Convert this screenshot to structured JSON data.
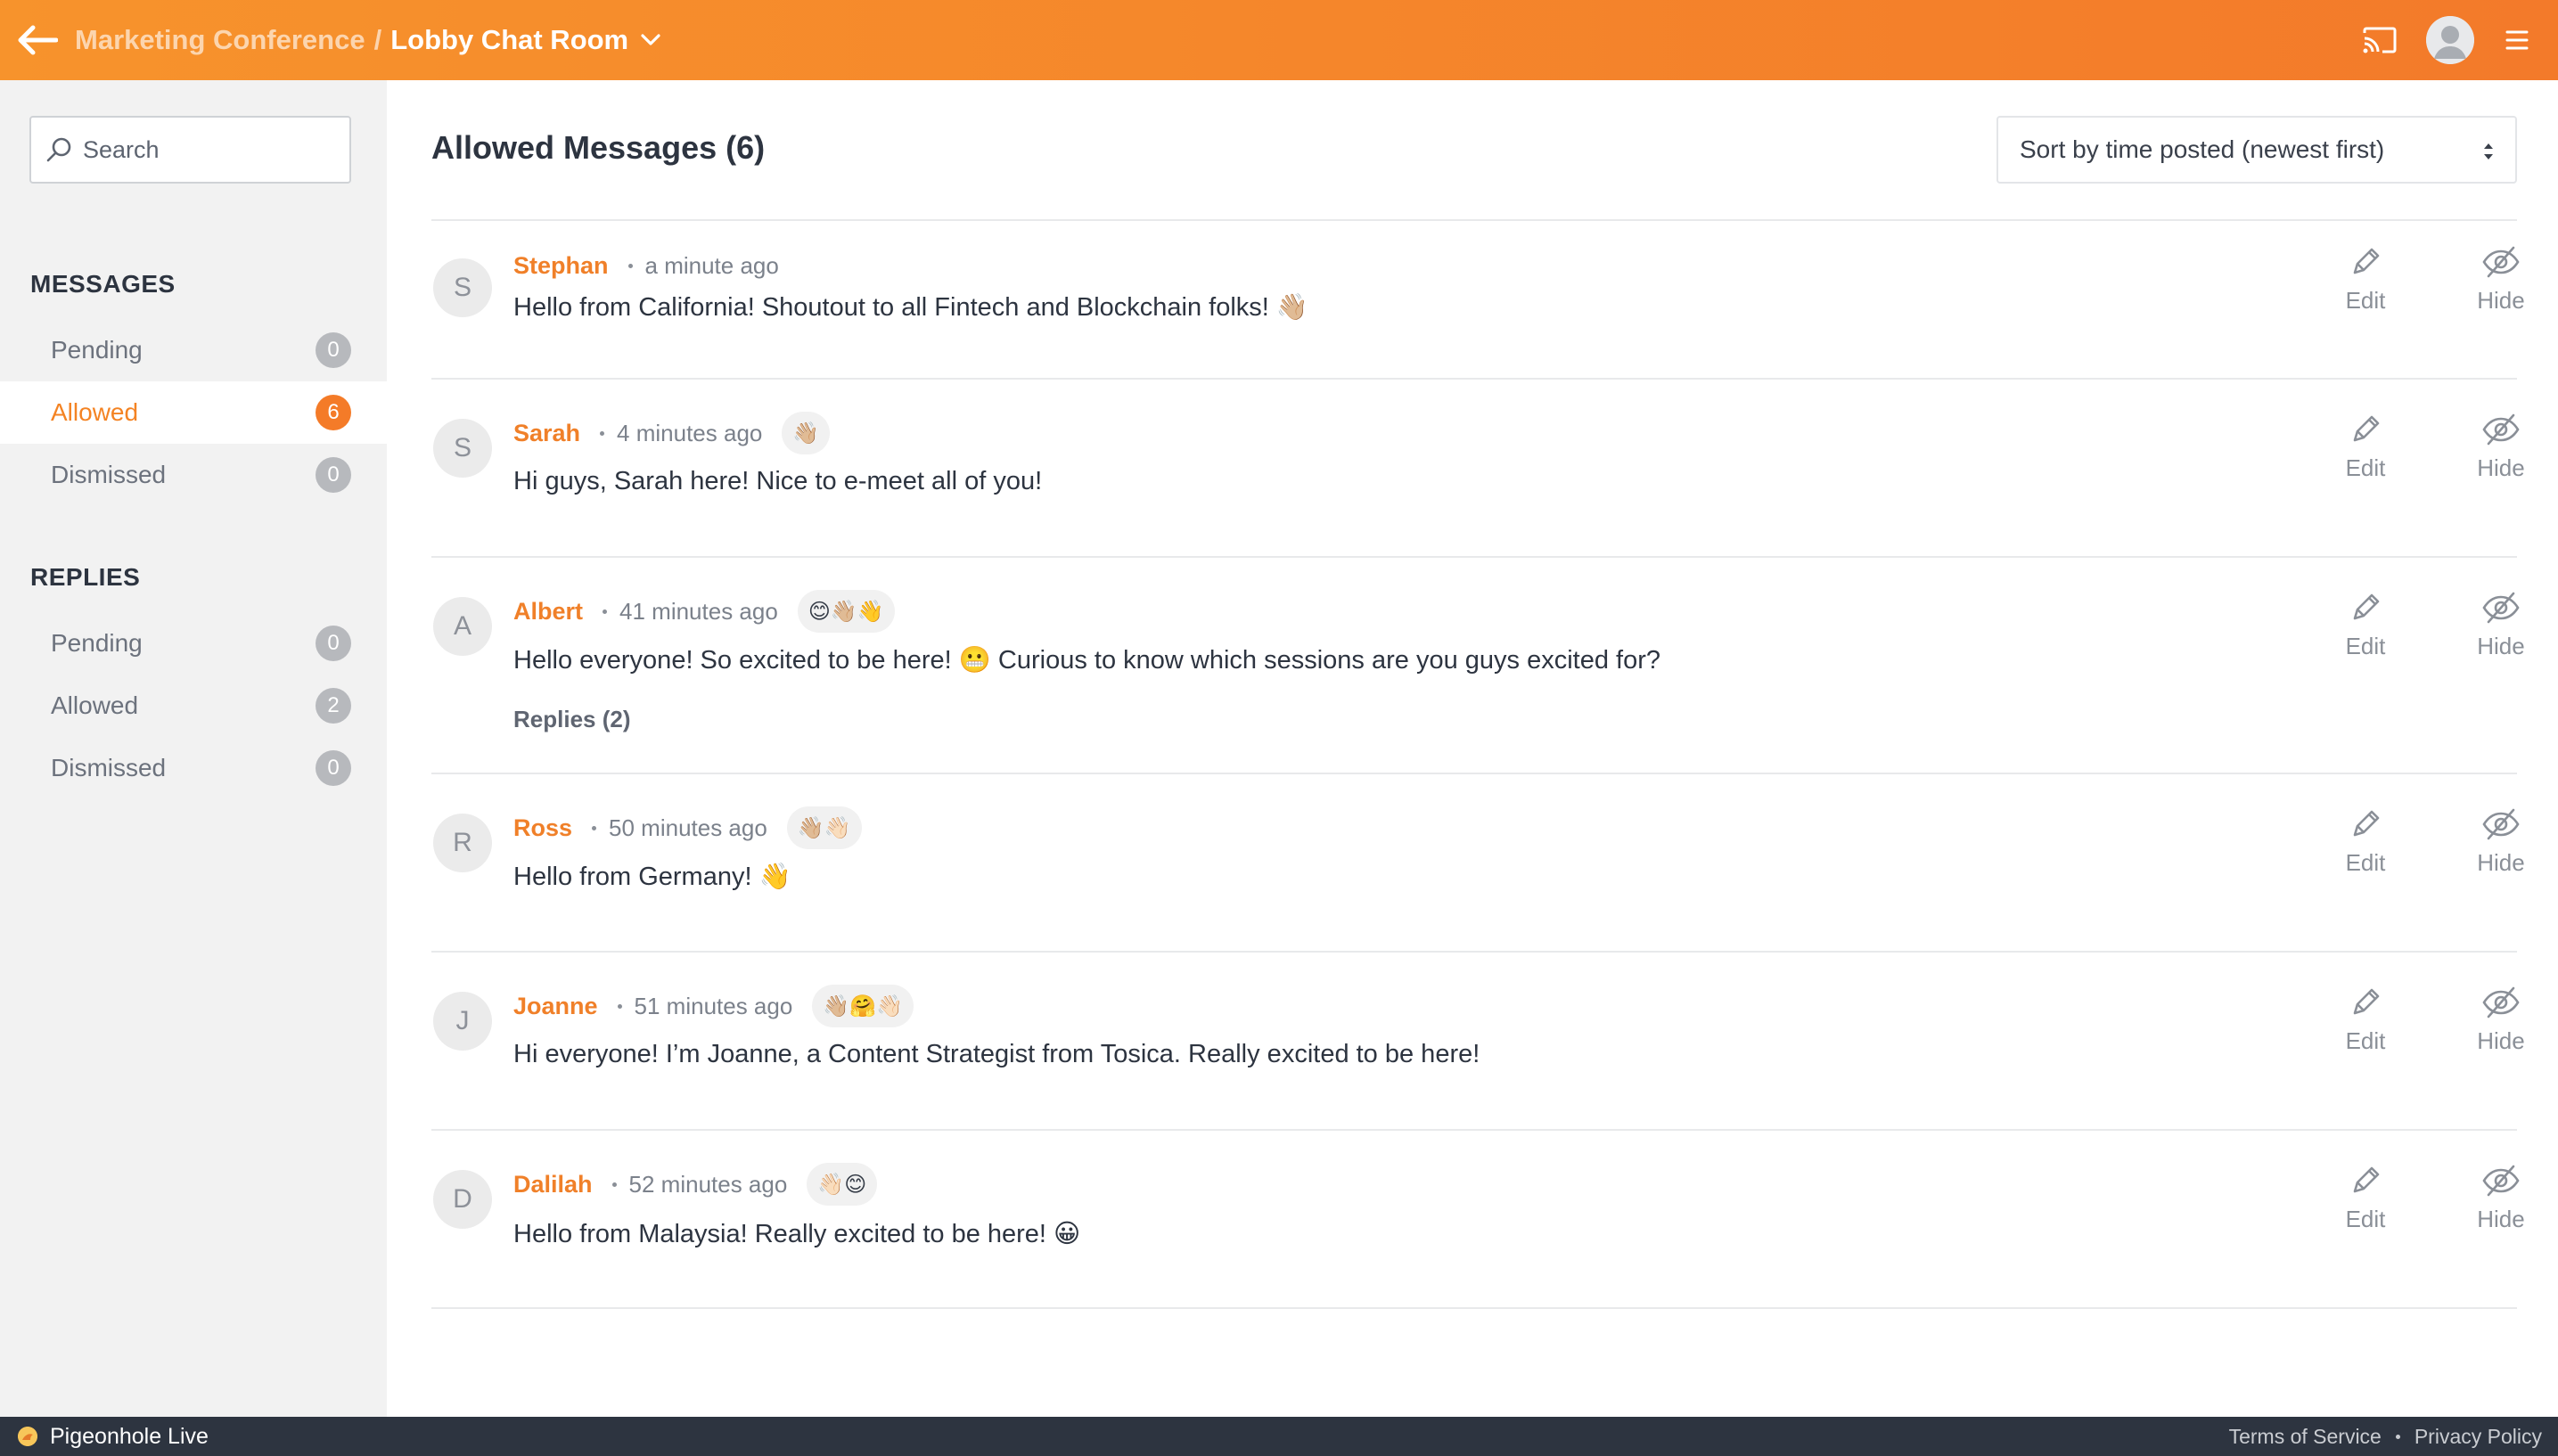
{
  "header": {
    "back_icon": "arrow-left-icon",
    "event_name": "Marketing Conference",
    "separator": "/",
    "room_name": "Lobby Chat Room",
    "accent": "#f58a2b"
  },
  "sidebar": {
    "search": {
      "placeholder": "Search",
      "value": ""
    },
    "messages": {
      "title": "MESSAGES",
      "items": [
        {
          "label": "Pending",
          "count": "0"
        },
        {
          "label": "Allowed",
          "count": "6"
        },
        {
          "label": "Dismissed",
          "count": "0"
        }
      ]
    },
    "replies": {
      "title": "REPLIES",
      "items": [
        {
          "label": "Pending",
          "count": "0"
        },
        {
          "label": "Allowed",
          "count": "2"
        },
        {
          "label": "Dismissed",
          "count": "0"
        }
      ]
    }
  },
  "main": {
    "title": "Allowed Messages (6)",
    "sort_value": "Sort by time posted (newest first)",
    "edit_label": "Edit",
    "hide_label": "Hide",
    "messages": [
      {
        "initial": "S",
        "author": "Stephan",
        "time": "a minute ago",
        "reactions": "",
        "text": "Hello from California! Shoutout to all Fintech and Blockchain folks! 👋🏼",
        "replies": ""
      },
      {
        "initial": "S",
        "author": "Sarah",
        "time": "4 minutes ago",
        "reactions": "👋🏼",
        "text": "Hi guys, Sarah here! Nice to e-meet all of you!",
        "replies": ""
      },
      {
        "initial": "A",
        "author": "Albert",
        "time": "41 minutes ago",
        "reactions": "😊👋🏼👋",
        "text": "Hello everyone! So excited to be here! 😬 Curious to know which sessions are you guys excited for?",
        "replies": "Replies (2)"
      },
      {
        "initial": "R",
        "author": "Ross",
        "time": "50 minutes ago",
        "reactions": "👋🏼👋🏻",
        "text": "Hello from Germany! 👋",
        "replies": ""
      },
      {
        "initial": "J",
        "author": "Joanne",
        "time": "51 minutes ago",
        "reactions": "👋🏼🤗👋🏻",
        "text": "Hi everyone! I’m Joanne, a Content Strategist from Tosica. Really excited to be here!",
        "replies": ""
      },
      {
        "initial": "D",
        "author": "Dalilah",
        "time": "52 minutes ago",
        "reactions": "👋🏻😊",
        "text": "Hello from Malaysia! Really excited to be here! 😀",
        "replies": ""
      }
    ]
  },
  "footer": {
    "brand": "Pigeonhole Live",
    "terms": "Terms of Service",
    "privacy": "Privacy Policy"
  }
}
